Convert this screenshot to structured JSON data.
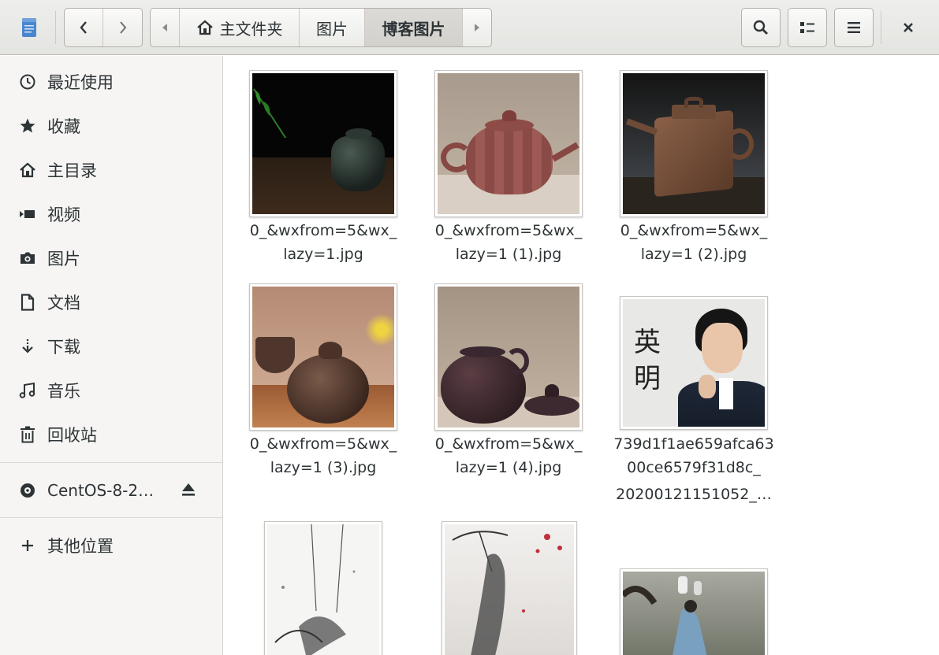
{
  "header": {
    "path": {
      "home": "主文件夹",
      "folder1": "图片",
      "folder2": "博客图片"
    }
  },
  "sidebar": {
    "items": [
      {
        "label": "最近使用",
        "icon": "clock-icon"
      },
      {
        "label": "收藏",
        "icon": "star-icon"
      },
      {
        "label": "主目录",
        "icon": "home-icon"
      },
      {
        "label": "视频",
        "icon": "video-icon"
      },
      {
        "label": "图片",
        "icon": "camera-icon"
      },
      {
        "label": "文档",
        "icon": "document-icon"
      },
      {
        "label": "下载",
        "icon": "download-icon"
      },
      {
        "label": "音乐",
        "icon": "music-icon"
      },
      {
        "label": "回收站",
        "icon": "trash-icon"
      }
    ],
    "device": {
      "label": "CentOS-8-2…",
      "icon": "disc-icon"
    },
    "other": {
      "label": "其他位置",
      "icon": "plus-icon"
    }
  },
  "files": [
    {
      "line1": "0_&wxfrom=5&wx_",
      "line2": "lazy=1.jpg",
      "line3": ""
    },
    {
      "line1": "0_&wxfrom=5&wx_",
      "line2": "lazy=1 (1).jpg",
      "line3": ""
    },
    {
      "line1": "0_&wxfrom=5&wx_",
      "line2": "lazy=1 (2).jpg",
      "line3": ""
    },
    {
      "line1": "0_&wxfrom=5&wx_",
      "line2": "lazy=1 (3).jpg",
      "line3": ""
    },
    {
      "line1": "0_&wxfrom=5&wx_",
      "line2": "lazy=1 (4).jpg",
      "line3": ""
    },
    {
      "line1": "739d1f1ae659afca63",
      "line2": "00ce6579f31d8c_",
      "line3": "20200121151052_…"
    }
  ],
  "thumb_text": {
    "char1": "英",
    "char2": "明"
  }
}
